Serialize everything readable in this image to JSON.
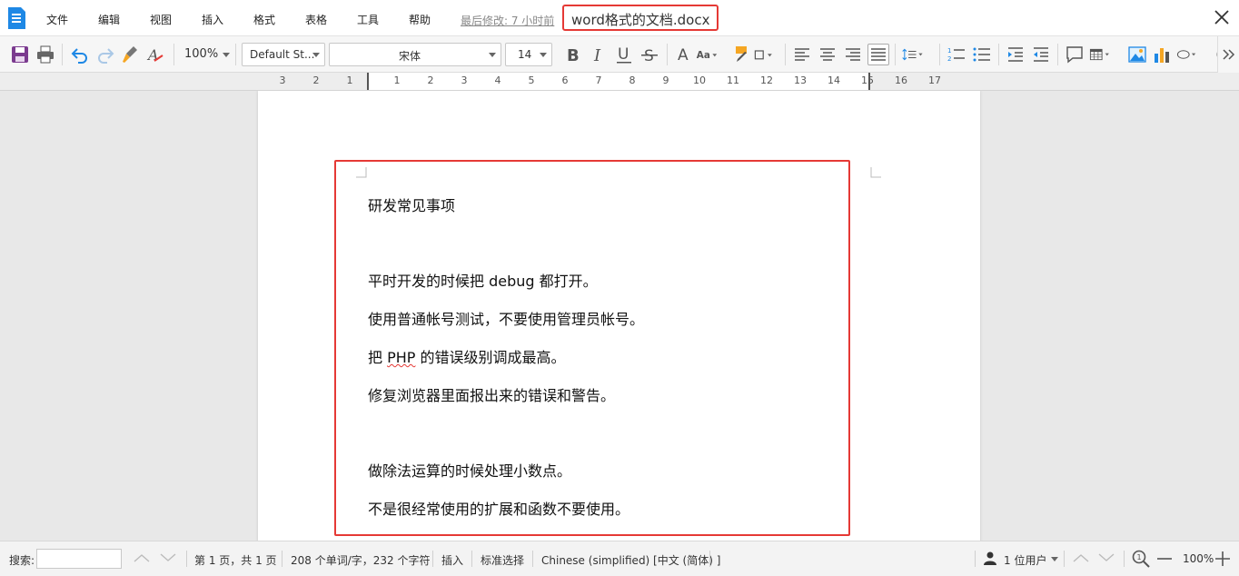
{
  "menubar": {
    "items": [
      "文件",
      "编辑",
      "视图",
      "插入",
      "格式",
      "表格",
      "工具",
      "帮助"
    ],
    "last_modified": "最后修改: 7 小时前",
    "doc_title": "word格式的文档.docx"
  },
  "toolbar": {
    "zoom": "100%",
    "style": "Default St...",
    "font": "宋体",
    "font_size": "14"
  },
  "ruler": {
    "left_ticks": [
      "3",
      "2",
      "1"
    ],
    "right_ticks": [
      "1",
      "2",
      "3",
      "4",
      "5",
      "6",
      "7",
      "8",
      "9",
      "10",
      "11",
      "12",
      "13",
      "14",
      "15",
      "16",
      "17"
    ]
  },
  "document": {
    "paragraphs": [
      "研发常见事项",
      "",
      "平时开发的时候把 debug 都打开。",
      "使用普通帐号测试，不要使用管理员帐号。",
      "把 PHP 的错误级别调成最高。",
      "修复浏览器里面报出来的错误和警告。",
      "",
      "做除法运算的时候处理小数点。",
      "不是很经常使用的扩展和函数不要使用。"
    ],
    "php_line_prefix": "把 ",
    "php_word": "PHP",
    "php_line_suffix": " 的错误级别调成最高。"
  },
  "statusbar": {
    "search_label": "搜索:",
    "page_info": "第 1 页，共 1 页",
    "word_count": "208 个单词/字，232 个字符",
    "insert_mode": "插入",
    "selection_mode": "标准选择",
    "language": "Chinese (simplified) [中文 (简体) ]",
    "users": "1 位用户",
    "zoom": "100%"
  },
  "colors": {
    "highlight_border": "#e53935",
    "accent_blue": "#1e88e5"
  }
}
